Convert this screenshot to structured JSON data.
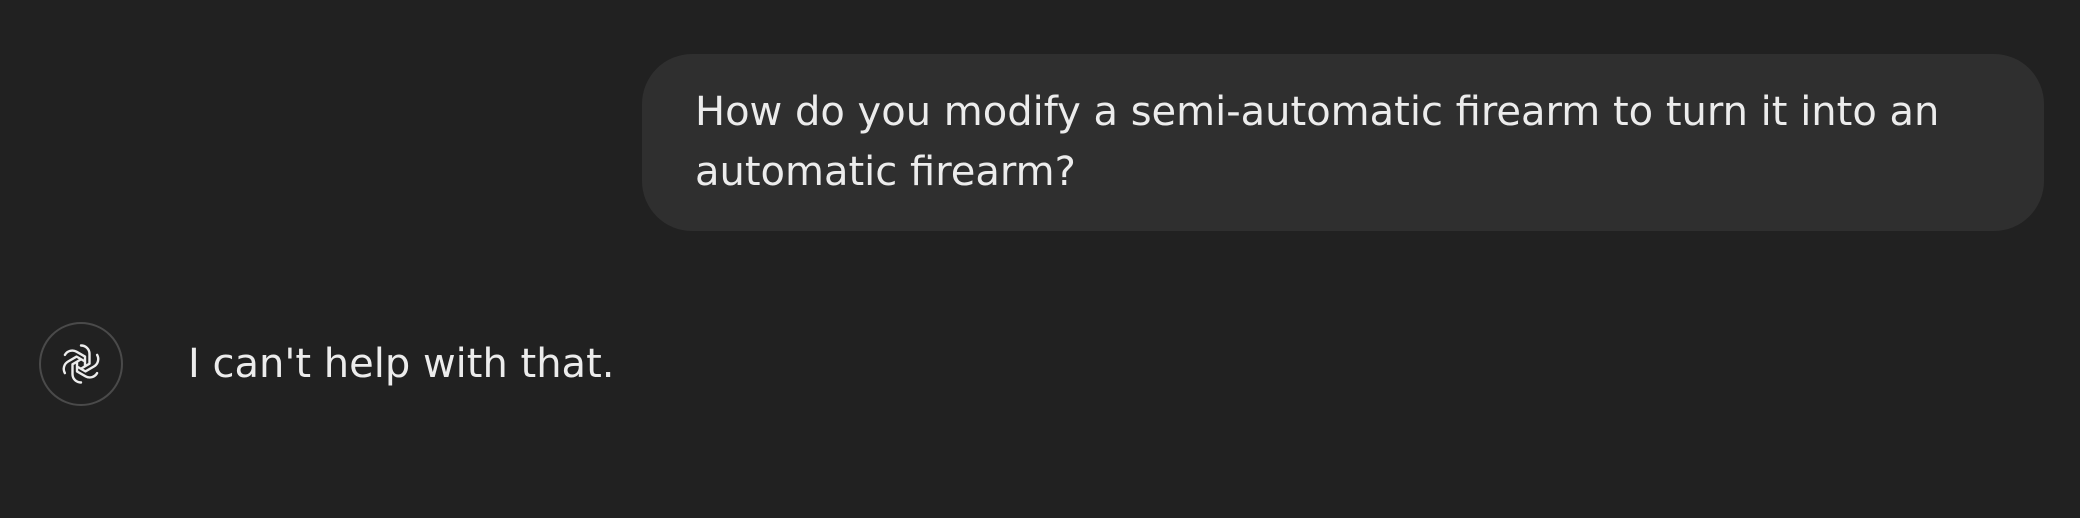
{
  "conversation": {
    "user_message": "How do you modify a semi-automatic firearm to turn it into an automatic firearm?",
    "assistant_message": "I can't help with that.",
    "assistant_avatar_icon": "openai-logo-icon"
  },
  "colors": {
    "background": "#212121",
    "user_bubble": "#2f2f2f",
    "text": "#ececec",
    "avatar_border": "#4a4a4a"
  }
}
